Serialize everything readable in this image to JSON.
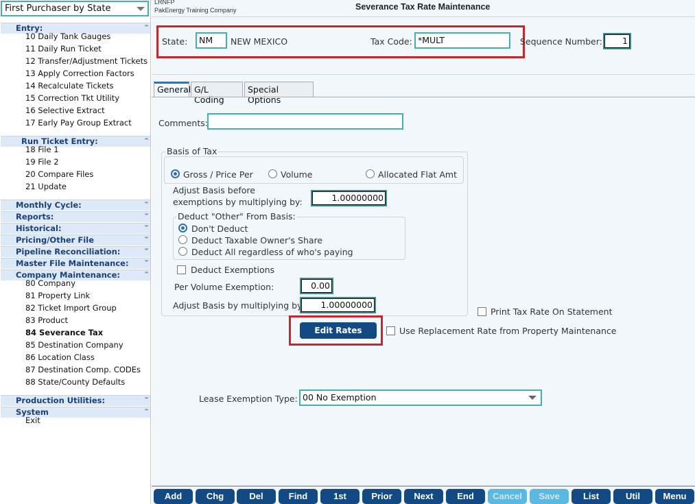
{
  "sidebar": {
    "selector": "First Purchaser by State",
    "sections": [
      {
        "label": "Entry:",
        "expanded": true,
        "items": [
          "10 Daily Tank Gauges",
          "11 Daily Run Ticket",
          "12 Transfer/Adjustment Tickets",
          "13 Apply Correction Factors",
          "14 Recalculate Tickets",
          "15 Correction Tkt Utility",
          "16 Selective Extract",
          "17 Early Pay Group Extract"
        ]
      },
      {
        "label": "Run Ticket Entry:",
        "expanded": true,
        "items": [
          "18 File 1",
          "19 File 2",
          "20 Compare Files",
          "21 Update"
        ]
      },
      {
        "label": "Monthly Cycle:",
        "expanded": false,
        "items": []
      },
      {
        "label": "Reports:",
        "expanded": false,
        "items": []
      },
      {
        "label": "Historical:",
        "expanded": false,
        "items": []
      },
      {
        "label": "Pricing/Other File Maintenance:",
        "expanded": false,
        "items": []
      },
      {
        "label": "Pipeline Reconciliation:",
        "expanded": false,
        "items": []
      },
      {
        "label": "Master File Maintenance:",
        "expanded": false,
        "items": []
      },
      {
        "label": "Company Maintenance:",
        "expanded": true,
        "items": [
          "80 Company",
          "81 Property Link",
          "82 Ticket Import Group",
          "83 Product",
          "84 Severance Tax",
          "85 Destination Company",
          "86 Location Class",
          "87 Destination Comp. CODEs",
          "88 State/County Defaults"
        ],
        "active": "84 Severance Tax"
      },
      {
        "label": "Production Utilities:",
        "expanded": false,
        "items": []
      },
      {
        "label": "System",
        "expanded": true,
        "items": [
          "Exit"
        ]
      }
    ]
  },
  "header": {
    "code": "LRNFP",
    "company": "PakEnergy Training Company",
    "title": "Severance Tax Rate Maintenance"
  },
  "key": {
    "state_label": "State:",
    "state_value": "NM",
    "state_name": "NEW MEXICO",
    "taxcode_label": "Tax Code:",
    "taxcode_value": "*MULT",
    "seq_label": "Sequence Number:",
    "seq_value": "1"
  },
  "tabs": [
    "General",
    "G/L Coding",
    "Special Options"
  ],
  "form": {
    "comments_label": "Comments:",
    "comments_value": "",
    "basis_title": "Basis of Tax",
    "basis_options": [
      "Gross / Price Per",
      "Volume",
      "Allocated Flat Amt"
    ],
    "basis_selected": "Gross / Price Per",
    "adjust_before_label1": "Adjust Basis before",
    "adjust_before_label2": "exemptions by multiplying by:",
    "adjust_before_value": "1.00000000",
    "deduct_title": "Deduct \"Other\" From Basis:",
    "deduct_options": [
      "Don't Deduct",
      "Deduct Taxable Owner's Share",
      "Deduct All regardless of who's paying"
    ],
    "deduct_selected": "Don't Deduct",
    "deduct_exemptions_label": "Deduct Exemptions",
    "deduct_exemptions_checked": false,
    "per_volume_label": "Per Volume Exemption:",
    "per_volume_value": "0.00",
    "adjust_label": "Adjust Basis by multiplying by:",
    "adjust_value": "1.00000000",
    "print_rate_label": "Print Tax Rate On Statement",
    "print_rate_checked": false,
    "edit_rates": "Edit Rates",
    "replacement_label": "Use Replacement Rate from Property Maintenance",
    "replacement_checked": false,
    "lease_label": "Lease Exemption Type:",
    "lease_value": "00 No Exemption"
  },
  "toolbar": [
    {
      "label": "Add",
      "enabled": true
    },
    {
      "label": "Chg",
      "enabled": true
    },
    {
      "label": "Del",
      "enabled": true
    },
    {
      "label": "Find",
      "enabled": true
    },
    {
      "label": "1st",
      "enabled": true
    },
    {
      "label": "Prior",
      "enabled": true
    },
    {
      "label": "Next",
      "enabled": true
    },
    {
      "label": "End",
      "enabled": true
    },
    {
      "label": "Cancel",
      "enabled": false
    },
    {
      "label": "Save",
      "enabled": false
    },
    {
      "label": "List",
      "enabled": true
    },
    {
      "label": "Util",
      "enabled": true
    },
    {
      "label": "Menu",
      "enabled": true
    }
  ],
  "colors": {
    "accent": "#144a84",
    "highlight_box": "#c8262b",
    "input_border": "#3fb1b5",
    "disabled_button": "#5bb8e0"
  }
}
